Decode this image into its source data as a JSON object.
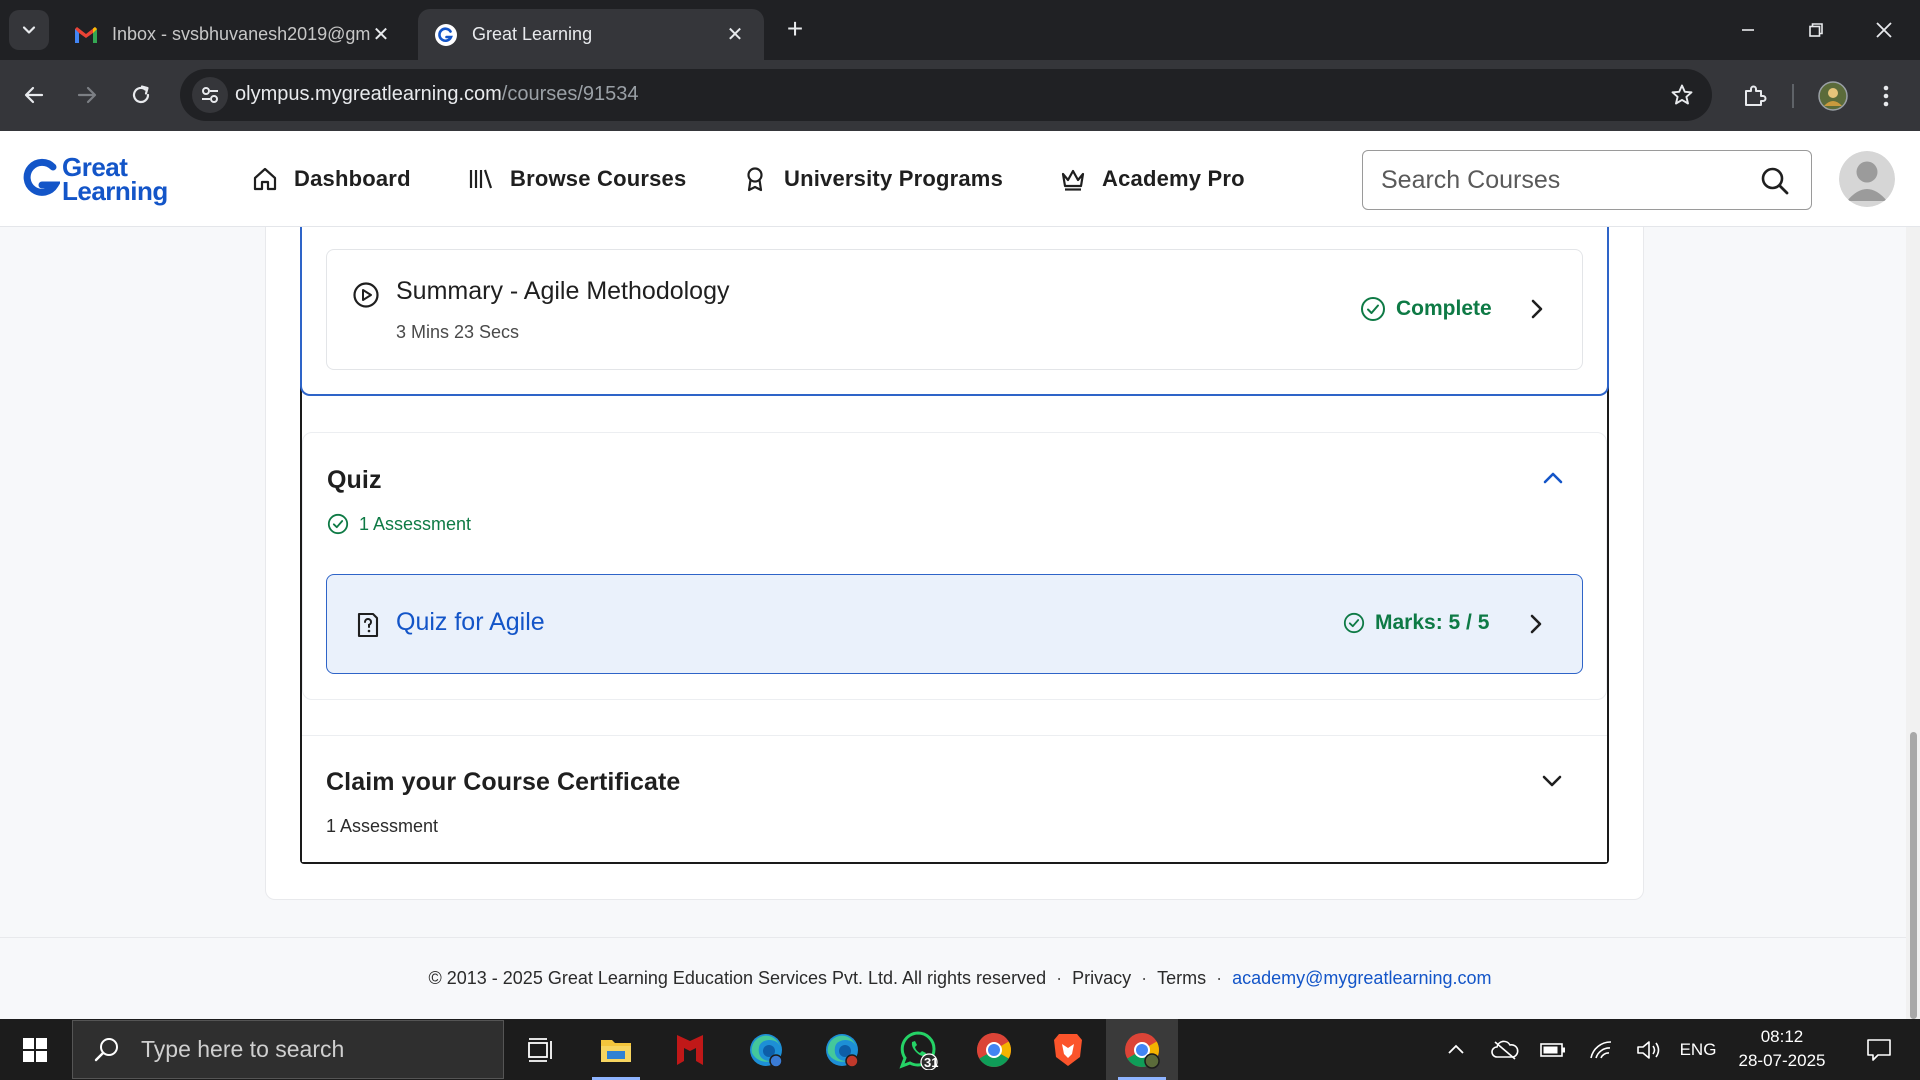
{
  "browser": {
    "tabs": [
      {
        "title": "Inbox - svsbhuvanesh2019@gm",
        "active": false
      },
      {
        "title": "Great Learning",
        "active": true
      }
    ],
    "url_host": "olympus.mygreatlearning.com",
    "url_path": "/courses/91534"
  },
  "header": {
    "logo_line1": "Great",
    "logo_line2": "Learning",
    "nav": {
      "dashboard": "Dashboard",
      "browse": "Browse Courses",
      "university": "University Programs",
      "academy": "Academy Pro"
    },
    "search_placeholder": "Search Courses"
  },
  "course": {
    "summary_lesson": {
      "title": "Summary - Agile Methodology",
      "duration": "3 Mins 23 Secs",
      "status": "Complete"
    },
    "quiz_section": {
      "title": "Quiz",
      "meta": "1 Assessment",
      "item": {
        "title": "Quiz for Agile",
        "marks": "Marks: 5 / 5"
      }
    },
    "certificate_section": {
      "title": "Claim your Course Certificate",
      "meta": "1 Assessment"
    }
  },
  "footer": {
    "copyright": "© 2013 - 2025 Great Learning Education Services Pvt. Ltd. All rights reserved",
    "privacy": "Privacy",
    "terms": "Terms",
    "email": "academy@mygreatlearning.com"
  },
  "taskbar": {
    "search_placeholder": "Type here to search",
    "whatsapp_badge": "31",
    "language": "ENG",
    "time": "08:12",
    "date": "28-07-2025"
  },
  "colors": {
    "brand_blue": "#1355c8",
    "success_green": "#0e7a45",
    "quiz_highlight_bg": "#eaf1fb"
  }
}
